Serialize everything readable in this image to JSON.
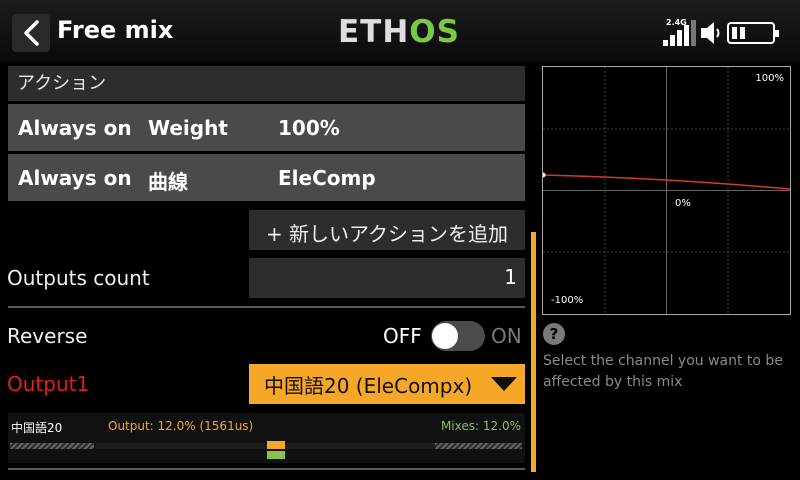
{
  "header": {
    "title": "Free mix",
    "logo_eth": "ETH",
    "logo_os": "OS",
    "signal_label": "2.4G"
  },
  "section": {
    "title": "アクション"
  },
  "actions": [
    {
      "condition": "Always on",
      "type": "Weight",
      "value": "100%"
    },
    {
      "condition": "Always on",
      "type": "曲線",
      "value": "EleComp"
    }
  ],
  "add_action_label": "+ 新しいアクションを追加",
  "outputs_count": {
    "label": "Outputs count",
    "value": "1"
  },
  "reverse": {
    "label": "Reverse",
    "off": "OFF",
    "on": "ON",
    "state": "OFF"
  },
  "output1": {
    "label": "Output1",
    "selected": "中国語20 (EleCompx)"
  },
  "monitor": {
    "channel": "中国語20",
    "output": "Output: 12.0% (1561us)",
    "mixes": "Mixes: 12.0%"
  },
  "curve": {
    "top_label": "100%",
    "mid_label": "0%",
    "bottom_label": "-100%"
  },
  "help": {
    "text": "Select the channel you want to be affected by this mix"
  },
  "colors": {
    "accent": "#f7a727",
    "output_label": "#e21e1e",
    "mixes": "#8bc34a",
    "logo_os": "#7ac943"
  }
}
